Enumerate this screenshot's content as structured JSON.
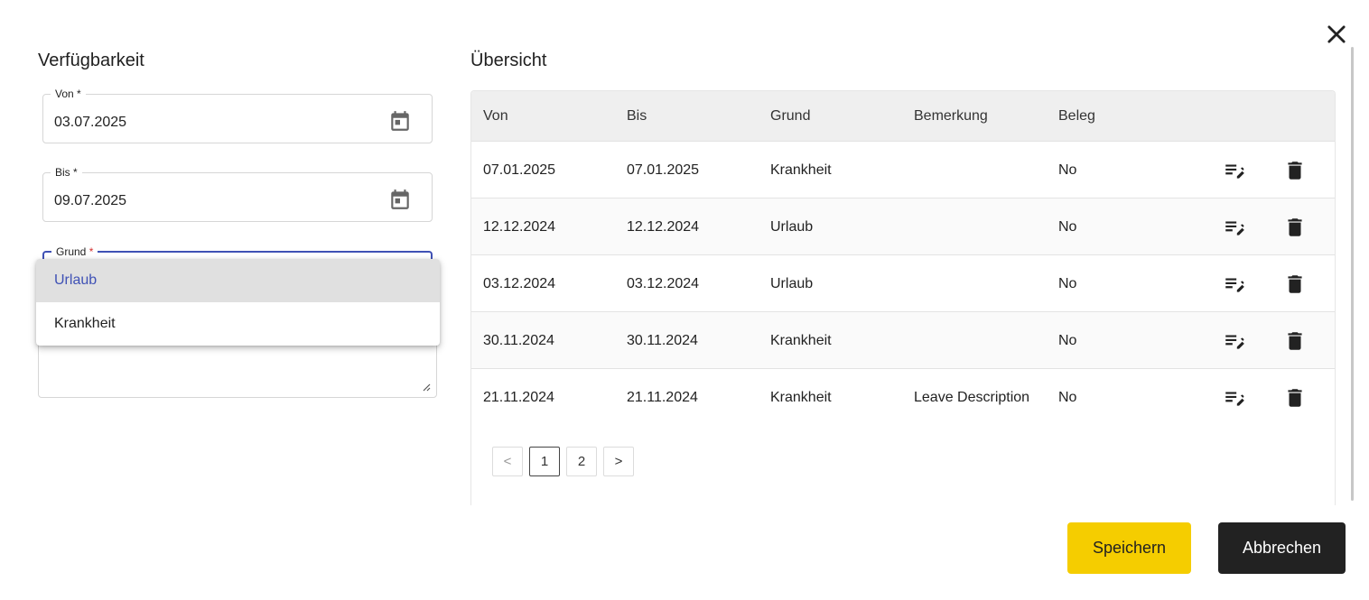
{
  "dialog": {
    "close_icon": "close-icon"
  },
  "left": {
    "title": "Verfügbarkeit",
    "von": {
      "label": "Von",
      "required_mark": "*",
      "value": "03.07.2025",
      "icon": "calendar-icon"
    },
    "bis": {
      "label": "Bis",
      "required_mark": "*",
      "value": "09.07.2025",
      "icon": "calendar-icon"
    },
    "grund": {
      "label": "Grund",
      "required_mark": "*",
      "options": [
        "Urlaub",
        "Krankheit"
      ],
      "highlighted": "Urlaub"
    },
    "bemerkung": {
      "value": ""
    }
  },
  "right": {
    "title": "Übersicht",
    "columns": [
      "Von",
      "Bis",
      "Grund",
      "Bemerkung",
      "Beleg"
    ],
    "rows": [
      {
        "von": "07.01.2025",
        "bis": "07.01.2025",
        "grund": "Krankheit",
        "bemerkung": "",
        "beleg": "No"
      },
      {
        "von": "12.12.2024",
        "bis": "12.12.2024",
        "grund": "Urlaub",
        "bemerkung": "",
        "beleg": "No"
      },
      {
        "von": "03.12.2024",
        "bis": "03.12.2024",
        "grund": "Urlaub",
        "bemerkung": "",
        "beleg": "No"
      },
      {
        "von": "30.11.2024",
        "bis": "30.11.2024",
        "grund": "Krankheit",
        "bemerkung": "",
        "beleg": "No"
      },
      {
        "von": "21.11.2024",
        "bis": "21.11.2024",
        "grund": "Krankheit",
        "bemerkung": "Leave Description",
        "beleg": "No"
      }
    ],
    "row_actions": [
      "edit-icon",
      "delete-icon"
    ],
    "pagination": {
      "prev": "<",
      "pages": [
        "1",
        "2"
      ],
      "current": "1",
      "next": ">"
    }
  },
  "footer": {
    "save_label": "Speichern",
    "cancel_label": "Abbrechen"
  },
  "colors": {
    "accent": "#3f51b5",
    "save_bg": "#f5cd00",
    "cancel_bg": "#222222",
    "header_bg": "#efefef"
  }
}
